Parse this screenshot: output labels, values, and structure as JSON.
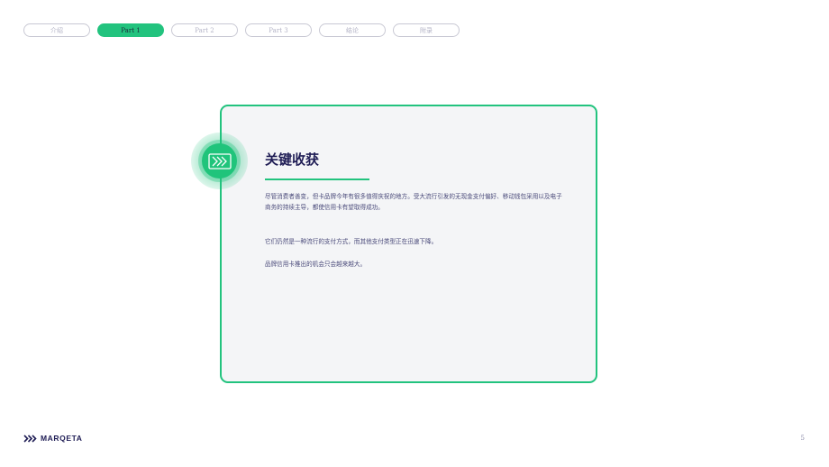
{
  "nav": {
    "tabs": [
      {
        "label": "介绍",
        "active": false
      },
      {
        "label": "Part 1",
        "active": true
      },
      {
        "label": "Part 2",
        "active": false
      },
      {
        "label": "Part 3",
        "active": false
      },
      {
        "label": "结论",
        "active": false
      },
      {
        "label": "附录",
        "active": false
      }
    ]
  },
  "card": {
    "icon": "chevrons-right-icon",
    "title": "关键收获",
    "paragraphs": [
      "尽管消费者善变，但卡品牌今年有很多值得庆祝的地方。受大流行引发的无现金支付偏好、移动钱包采用以及电子商务的持续主导，都使信用卡有望取得成功。",
      "它们仍然是一种流行的支付方式，而其他支付类型正在迅速下降。",
      "品牌信用卡推出的机会只会越来越大。"
    ]
  },
  "footer": {
    "brand": "MARQETA",
    "page_number": "5"
  },
  "colors": {
    "accent": "#22c37e",
    "title": "#1f1d55",
    "body_text": "#4a4a7a",
    "card_background": "#f4f5f7"
  }
}
